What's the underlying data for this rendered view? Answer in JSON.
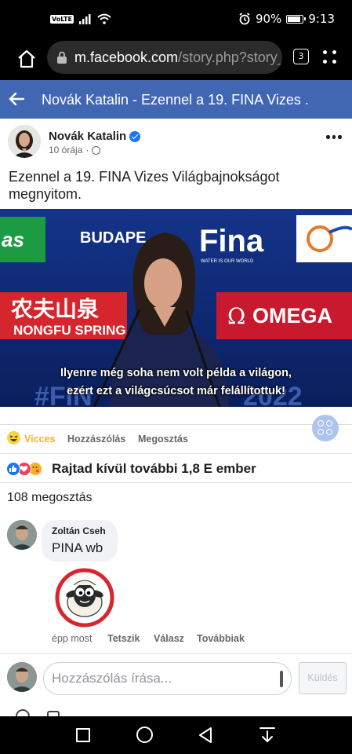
{
  "status_bar": {
    "network_badge": "VoLTE",
    "battery": "90%",
    "battery_level": 0.9,
    "time": "9:13"
  },
  "browser": {
    "url_domain": "m.facebook.com",
    "url_path": "/story.php?story_f",
    "tab_count": "3"
  },
  "header": {
    "title": "Novák Katalin - Ezennel a 19. FINA Vizes ..."
  },
  "post": {
    "author": "Novák Katalin",
    "time": "10 órája",
    "separator": "·",
    "text": "Ezennel a 19. FINA Vizes Világbajnokságot megnyitom.",
    "video": {
      "subtitle_line1": "Ilyenre még soha nem volt példa a világon,",
      "subtitle_line2": "ezért ezt a világcsúcsot már felállítottuk!",
      "banner_budapest": "BUDAPE",
      "banner_fina": "Fina",
      "banner_fina_tag": "WATER IS OUR WORLD",
      "banner_chinese": "农夫山泉",
      "banner_nongfu": "NONGFU SPRING",
      "banner_omega_symbol": "Ω",
      "banner_omega": "OMEGA",
      "banner_as": "as",
      "banner_bottom_left": "#FIN",
      "banner_bottom_right": "2022"
    }
  },
  "actions": {
    "reaction_label": "Vicces",
    "comment_label": "Hozzászólás",
    "share_label": "Megosztás"
  },
  "reactions": {
    "summary": "Rajtad kívül további 1,8 E ember",
    "colors": {
      "like": "#1877f2",
      "love": "#f33e58",
      "care": "#f7b125"
    }
  },
  "shares_text": "108 megosztás",
  "comment": {
    "author": "Zoltán Cseh",
    "text": "PINA wb",
    "time": "épp most",
    "like": "Tetszik",
    "reply": "Válasz",
    "more": "Továbbiak"
  },
  "composer": {
    "placeholder": "Hozzászólás írása...",
    "send": "Küldés"
  }
}
